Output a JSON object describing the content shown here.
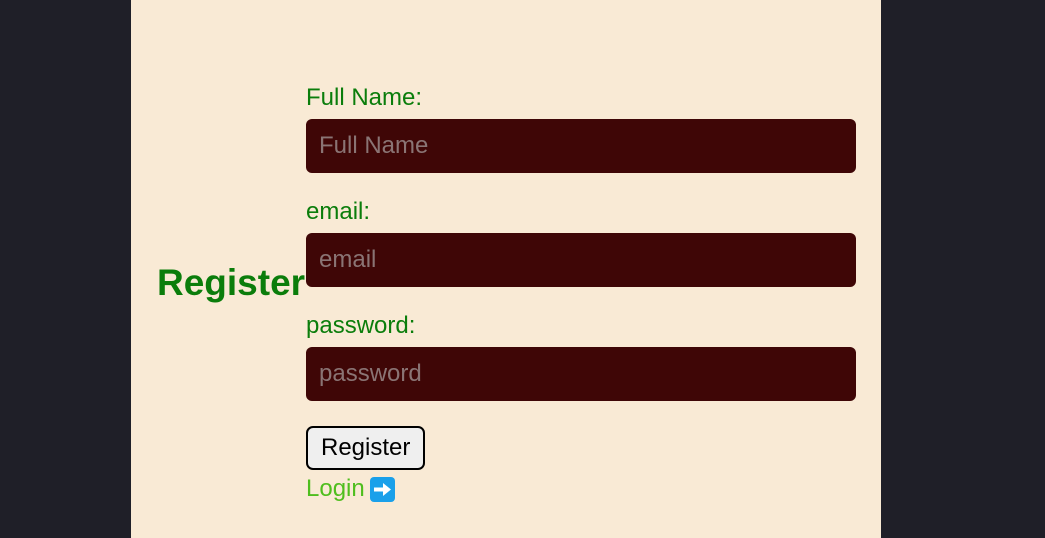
{
  "page": {
    "heading": "Register"
  },
  "form": {
    "full_name": {
      "label": "Full Name:",
      "placeholder": "Full Name",
      "value": ""
    },
    "email": {
      "label": "email:",
      "placeholder": "email",
      "value": ""
    },
    "password": {
      "label": "password:",
      "placeholder": "password",
      "value": ""
    },
    "submit_label": "Register",
    "login_link": {
      "label": "Login",
      "icon": "right-arrow-icon"
    }
  },
  "colors": {
    "background": "#1f1f28",
    "panel": "#f9ead5",
    "label_text": "#0b7d0b",
    "input_background": "#3f0606",
    "link": "#4fbe1e",
    "arrow_badge": "#1aa0ea"
  }
}
